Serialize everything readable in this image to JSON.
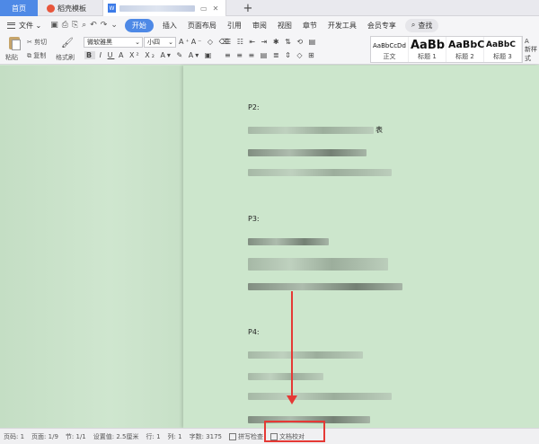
{
  "tabs": {
    "home": "首页",
    "store": "稻壳模板",
    "doc_icon": "W",
    "new_tab": "+"
  },
  "menu": {
    "file": "文件",
    "active": "开始",
    "items": [
      "插入",
      "页面布局",
      "引用",
      "审阅",
      "视图",
      "章节",
      "开发工具",
      "会员专享"
    ],
    "search": "查找"
  },
  "ribbon": {
    "paste": "粘贴",
    "cut": "剪切",
    "copy": "复制",
    "format_painter": "格式刷",
    "font": "微软雅黑",
    "size": "小四",
    "styles": [
      {
        "sample": "AaBbCcDd",
        "name": "正文"
      },
      {
        "sample": "AaBb",
        "name": "标题 1"
      },
      {
        "sample": "AaBbC",
        "name": "标题 2"
      },
      {
        "sample": "AaBbC",
        "name": "标题 3"
      }
    ],
    "new_style": "新样式"
  },
  "document": {
    "p2": "P2:",
    "p2_tail": "表",
    "p3": "P3:",
    "p4": "P4:"
  },
  "status": {
    "page_num": "页码: 1",
    "pages": "页面: 1/9",
    "section": "节: 1/1",
    "setting": "设置值: 2.5厘米",
    "row": "行: 1",
    "col": "列: 1",
    "words": "字数: 3175",
    "spell_check": "拼写检查",
    "doc_proof": "文档校对"
  },
  "colors": {
    "accent": "#4e89e6",
    "page_bg": "#cce6cc",
    "annotation": "#e53935"
  }
}
